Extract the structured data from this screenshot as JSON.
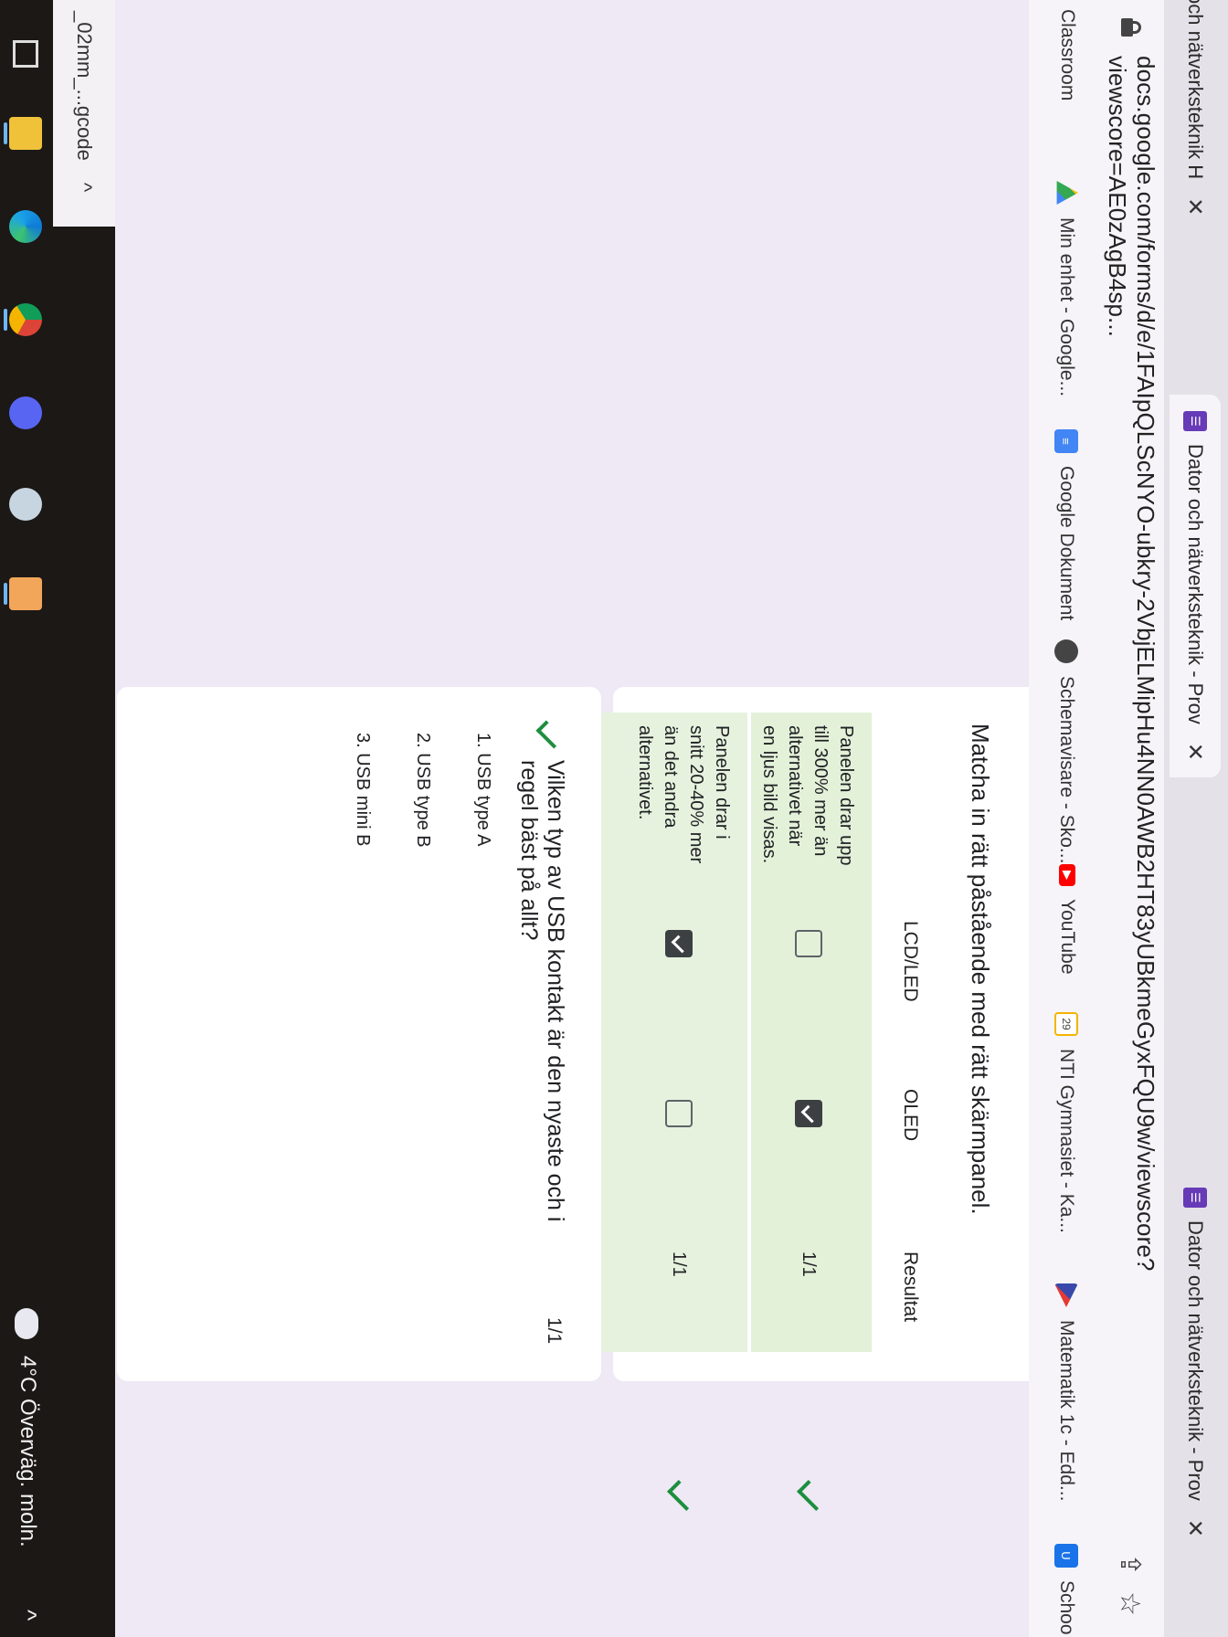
{
  "tabs": [
    {
      "label": "och nätverksteknik H",
      "close": "✕"
    },
    {
      "label": "Dator och nätverksteknik - Prov",
      "close": "✕"
    },
    {
      "label": "Dator och nätverksteknik - Prov",
      "close": "✕"
    }
  ],
  "address_bar": {
    "url": "docs.google.com/forms/d/e/1FAIpQLScNYO-ubkry-2VbjELMipHu4NN0AWB2HT83yUBkmeGyxFQU9w/viewscore?viewscore=AE0zAgB4sp..."
  },
  "bookmarks": [
    {
      "label": "Classroom",
      "icon": "classroom-icon"
    },
    {
      "label": "Min enhet - Google...",
      "icon": "google-drive-icon"
    },
    {
      "label": "Google Dokument",
      "icon": "google-docs-icon"
    },
    {
      "label": "Schemavisare - Sko...",
      "icon": "globe-icon"
    },
    {
      "label": "YouTube",
      "icon": "youtube-icon"
    },
    {
      "label": "NTI Gymnasiet - Ka...",
      "icon": "calendar-icon",
      "badge": "29"
    },
    {
      "label": "Matematik 1c - Edd...",
      "icon": "bookmark-icon"
    },
    {
      "label": "Schoo",
      "icon": "school-icon"
    }
  ],
  "match_question": {
    "title": "Matcha in rätt påstående med rätt skärmpanel.",
    "columns": [
      "LCD/LED",
      "OLED",
      "Resultat"
    ],
    "rows": [
      {
        "label": "Panelen drar upp till 300% mer än alternativet när en ljus bild visas.",
        "lcd_checked": false,
        "oled_checked": true,
        "score": "1/1",
        "correct": true
      },
      {
        "label": "Panelen drar i snitt 20-40% mer än det andra alternativet.",
        "lcd_checked": true,
        "oled_checked": false,
        "score": "1/1",
        "correct": true
      }
    ]
  },
  "usb_question": {
    "question": "Vilken typ av USB kontakt är den nyaste och i regel bäst på allt?",
    "score": "1/1",
    "options": [
      "1. USB type A",
      "2. USB type B",
      "3. USB mini B"
    ]
  },
  "taskbar": {
    "download_label": "_02mm_...gcode",
    "download_chevron": "^",
    "weather": "4°C Överväg. moln.",
    "tray_chevron": "^",
    "colors": {
      "accent": "#6fb6f5",
      "check": "#1e8e3e",
      "row_bg": "#e3f1d9"
    }
  }
}
